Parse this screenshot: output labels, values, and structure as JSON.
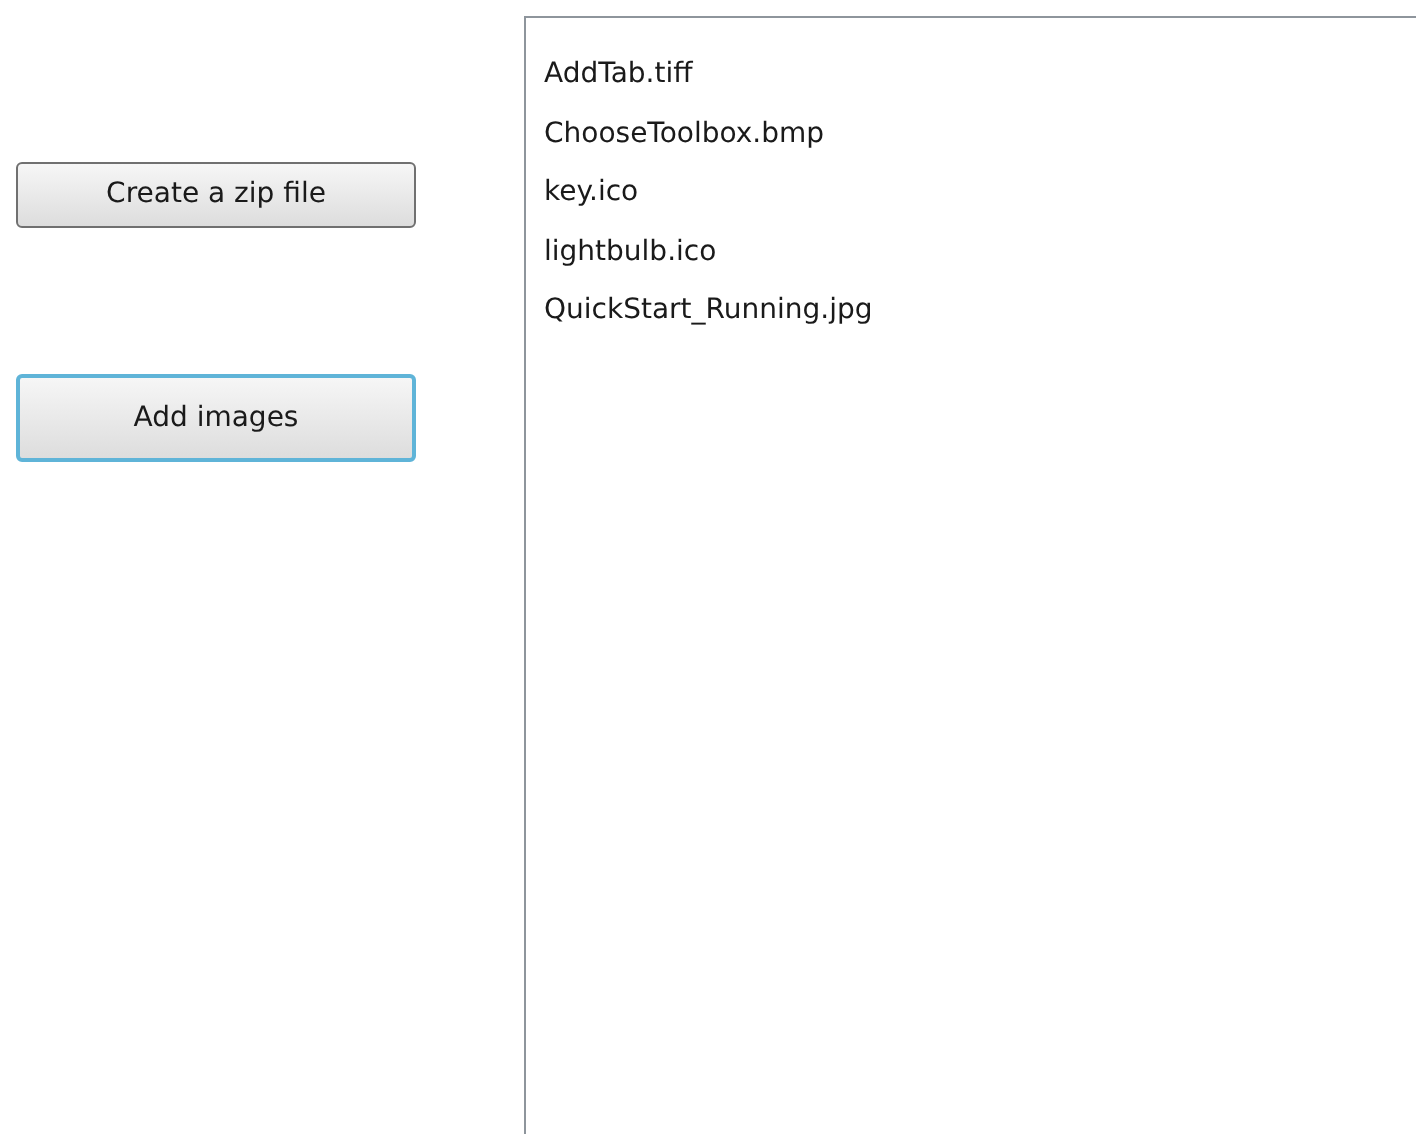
{
  "buttons": [
    {
      "label": "Create a zip file",
      "focused": false
    },
    {
      "label": "Add images",
      "focused": true
    }
  ],
  "file_list": {
    "items": [
      "AddTab.tiff",
      "ChooseToolbox.bmp",
      "key.ico",
      "lightbulb.ico",
      "QuickStart_Running.jpg"
    ]
  }
}
